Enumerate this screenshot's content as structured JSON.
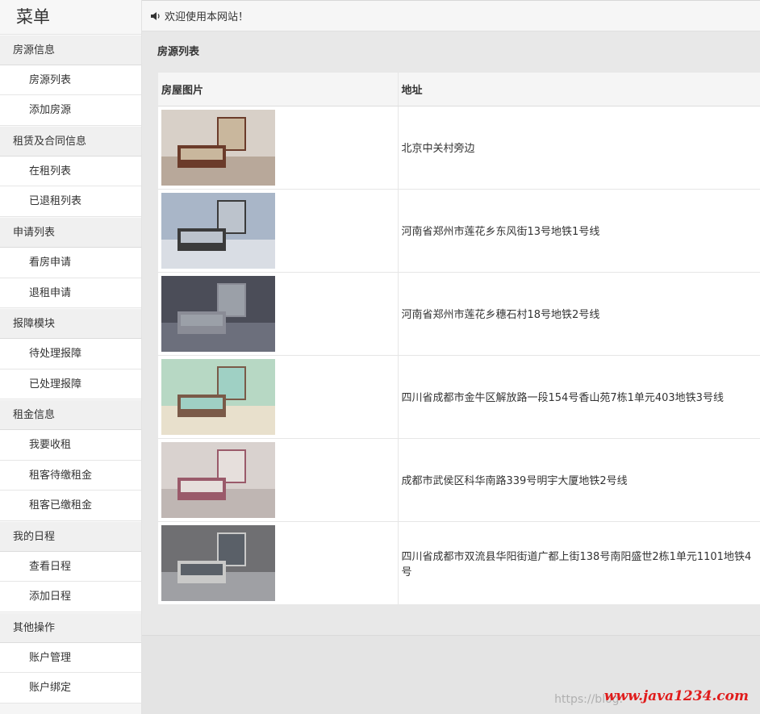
{
  "sidebar": {
    "title": "菜单",
    "groups": [
      {
        "label": "房源信息",
        "items": [
          "房源列表",
          "添加房源"
        ]
      },
      {
        "label": "租赁及合同信息",
        "items": [
          "在租列表",
          "已退租列表"
        ]
      },
      {
        "label": "申请列表",
        "items": [
          "看房申请",
          "退租申请"
        ]
      },
      {
        "label": "报障模块",
        "items": [
          "待处理报障",
          "已处理报障"
        ]
      },
      {
        "label": "租金信息",
        "items": [
          "我要收租",
          "租客待缴租金",
          "租客已缴租金"
        ]
      },
      {
        "label": "我的日程",
        "items": [
          "查看日程",
          "添加日程"
        ]
      },
      {
        "label": "其他操作",
        "items": [
          "账户管理",
          "账户绑定"
        ]
      }
    ]
  },
  "topbar": {
    "icon": "speaker-icon",
    "welcome": "欢迎使用本网站！"
  },
  "main": {
    "heading": "房源列表",
    "table": {
      "headers": [
        "房屋图片",
        "地址"
      ],
      "rows": [
        {
          "image": "bedroom-photo",
          "address": "北京中关村旁边"
        },
        {
          "image": "studio-photo",
          "address": "河南省郑州市莲花乡东风街13号地铁1号线"
        },
        {
          "image": "empty-room-photo",
          "address": "河南省郑州市莲花乡穗石村18号地铁2号线"
        },
        {
          "image": "living-room-photo",
          "address": "四川省成都市金牛区解放路一段154号香山苑7栋1单元403地铁3号线"
        },
        {
          "image": "bedroom-bed-photo",
          "address": "成都市武侯区科华南路339号明宇大厦地铁2号线"
        },
        {
          "image": "apartment-photo",
          "address": "四川省成都市双流县华阳街道广都上街138号南阳盛世2栋1单元1101地铁4号"
        }
      ]
    }
  },
  "watermark": {
    "url": "https://blog.",
    "brand": "www.java1234.com"
  }
}
